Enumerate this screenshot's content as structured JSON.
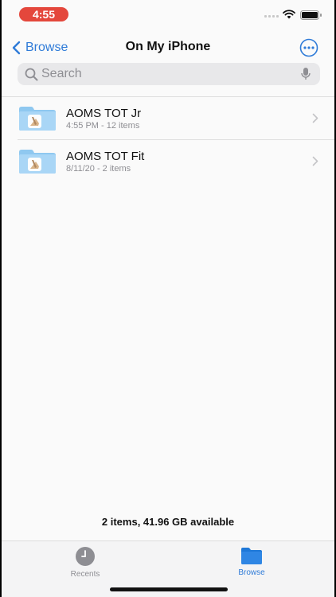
{
  "status_bar": {
    "time": "4:55",
    "time_pill_color": "#e4473c"
  },
  "nav": {
    "back_label": "Browse",
    "title": "On My iPhone",
    "more_icon": "ellipsis-circle-icon",
    "accent_color": "#2f7bd8"
  },
  "search": {
    "placeholder": "Search",
    "value": ""
  },
  "files": [
    {
      "name": "AOMS TOT Jr",
      "meta": "4:55 PM - 12 items",
      "icon": "folder-icon"
    },
    {
      "name": "AOMS TOT Fit",
      "meta": "8/11/20 - 2 items",
      "icon": "folder-icon"
    }
  ],
  "footer": {
    "storage_text": "2 items, 41.96 GB available"
  },
  "tabs": [
    {
      "label": "Recents",
      "icon": "clock-icon",
      "active": false
    },
    {
      "label": "Browse",
      "icon": "folder-icon",
      "active": true
    }
  ]
}
